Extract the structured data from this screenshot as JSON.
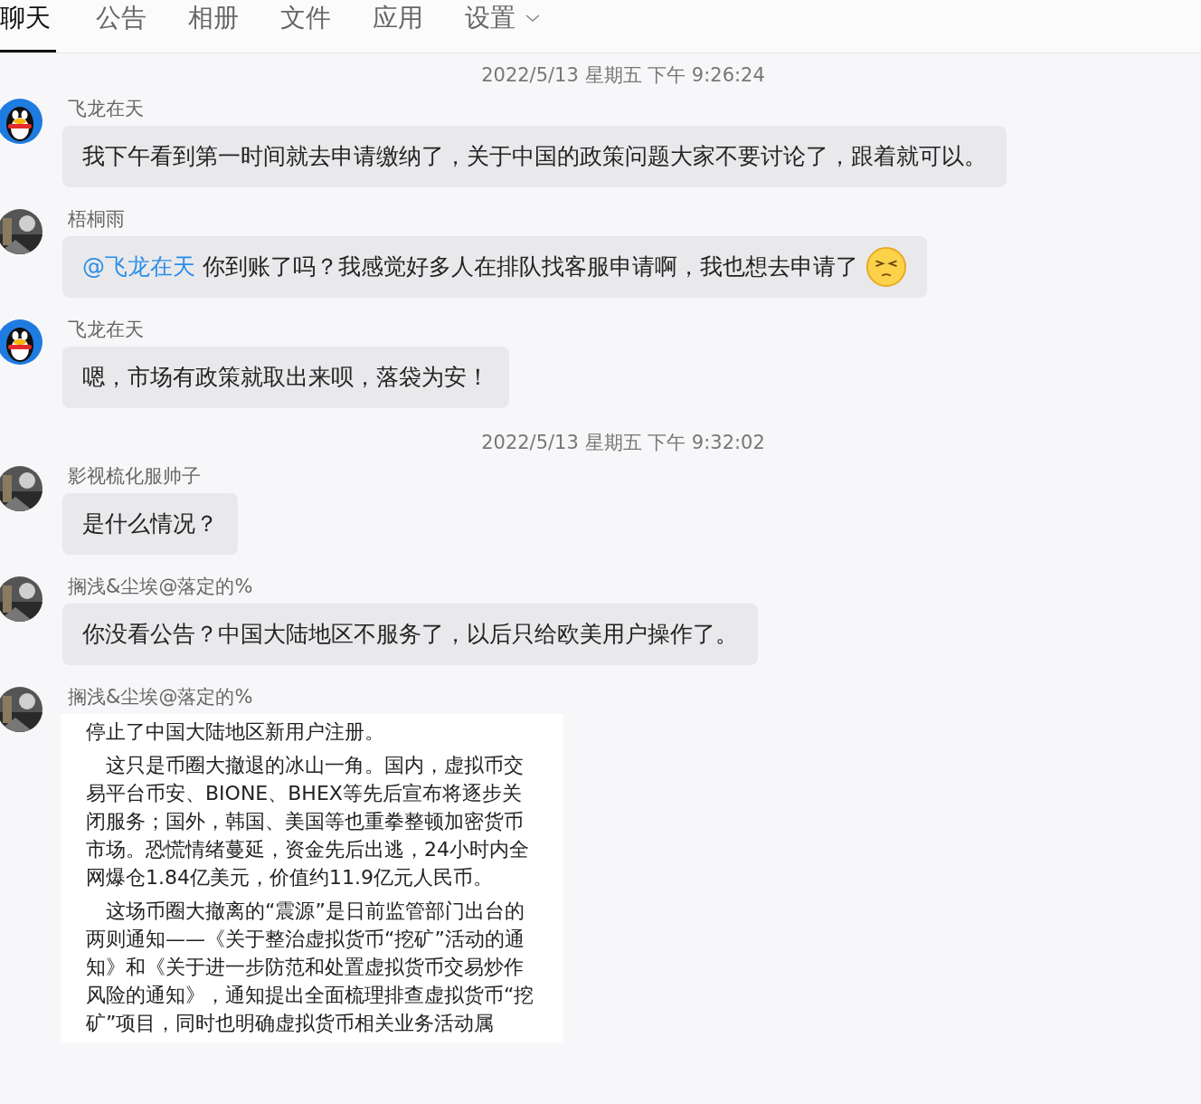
{
  "tabs": [
    {
      "label": "聊天",
      "selected": true
    },
    {
      "label": "公告",
      "selected": false
    },
    {
      "label": "相册",
      "selected": false
    },
    {
      "label": "文件",
      "selected": false
    },
    {
      "label": "应用",
      "selected": false
    },
    {
      "label": "设置",
      "selected": false,
      "dropdown": true
    }
  ],
  "feed": [
    {
      "kind": "time",
      "text": "2022/5/13 星期五 下午 9:26:24"
    },
    {
      "kind": "message",
      "sender": "飞龙在天",
      "avatar": {
        "kind": "penguin"
      },
      "text": "我下午看到第一时间就去申请缴纳了，关于中国的政策问题大家不要讨论了，跟着就可以。"
    },
    {
      "kind": "message",
      "sender": "梧桐雨",
      "mention": "@飞龙在天",
      "text": "你到账了吗？我感觉好多人在排队找客服申请啊，我也想去申请了",
      "emoji": true
    },
    {
      "kind": "message",
      "sender": "飞龙在天",
      "avatar": {
        "kind": "penguin"
      },
      "text": "嗯，市场有政策就取出来呗，落袋为安！"
    },
    {
      "kind": "time",
      "text": "2022/5/13 星期五 下午 9:32:02"
    },
    {
      "kind": "message",
      "sender": "影视梳化服帅子",
      "text": "是什么情况？"
    },
    {
      "kind": "message",
      "sender": "搁浅&尘埃@落定的%",
      "text": "你没看公告？中国大陆地区不服务了，以后只给欧美用户操作了。"
    },
    {
      "kind": "article",
      "sender": "搁浅&尘埃@落定的%",
      "paragraphs": [
        "停止了中国大陆地区新用户注册。",
        "这只是币圈大撤退的冰山一角。国内，虚拟币交易平台币安、BIONE、BHEX等先后宣布将逐步关闭服务；国外，韩国、美国等也重拳整顿加密货币市场。恐慌情绪蔓延，资金先后出逃，24小时内全网爆仓1.84亿美元，价值约11.9亿元人民币。",
        "这场币圈大撤离的“震源”是日前监管部门出台的两则通知——《关于整治虚拟货币“挖矿”活动的通知》和《关于进一步防范和处置虚拟货币交易炒作风险的通知》，通知提出全面梳理排查虚拟货币“挖矿”项目，同时也明确虚拟货币相关业务活动属"
      ]
    }
  ]
}
